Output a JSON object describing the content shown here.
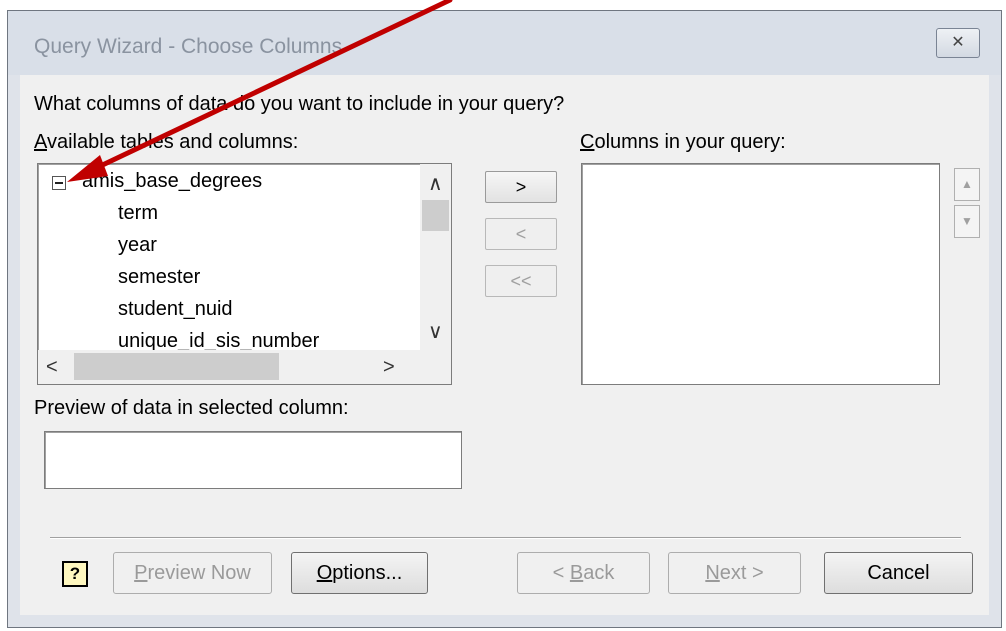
{
  "window": {
    "title": "Query Wizard - Choose Columns",
    "close_glyph": "✕"
  },
  "prompt": "What columns of data do you want to include in your query?",
  "available": {
    "label_accel": "A",
    "label_rest": "vailable tables and columns:",
    "table_name": "amis_base_degrees",
    "columns": [
      "term",
      "year",
      "semester",
      "student_nuid",
      "unique_id_sis_number"
    ]
  },
  "move_buttons": {
    "add": ">",
    "remove": "<",
    "remove_all": "<<"
  },
  "query_columns": {
    "label_accel": "C",
    "label_rest": "olumns in your query:"
  },
  "preview": {
    "label": "Preview of data in selected column:",
    "value": ""
  },
  "buttons": {
    "help": "?",
    "preview_accel": "P",
    "preview_rest": "review Now",
    "options_accel": "O",
    "options_rest": "ptions...",
    "back_pre": "< ",
    "back_accel": "B",
    "back_rest": "ack",
    "next_accel": "N",
    "next_rest": "ext >",
    "cancel": "Cancel"
  },
  "scroll_icons": {
    "up": "∧",
    "down": "∨",
    "left": "<",
    "right": ">",
    "side_up": "▲",
    "side_down": "▼"
  },
  "annotation": {
    "color": "#c00000"
  }
}
